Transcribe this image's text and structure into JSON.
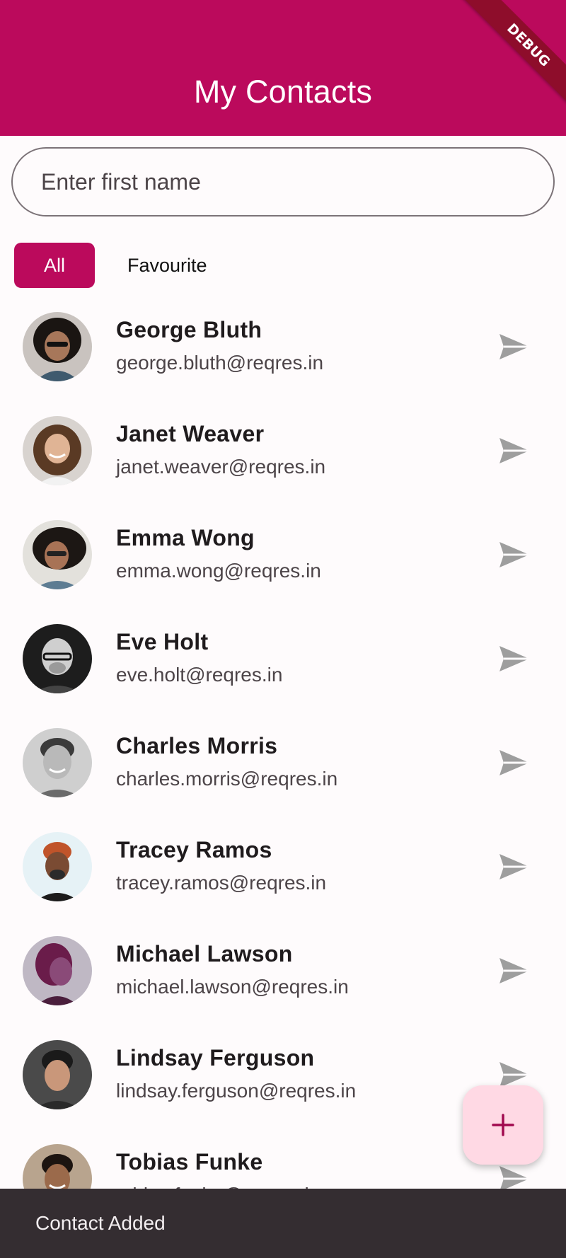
{
  "appbar": {
    "title": "My Contacts",
    "debug_label": "DEBUG"
  },
  "search": {
    "placeholder": "Enter first name",
    "value": ""
  },
  "filters": {
    "all_label": "All",
    "favourite_label": "Favourite",
    "selected": "All"
  },
  "contacts": [
    {
      "name": "George Bluth",
      "email": "george.bluth@reqres.in",
      "avatar_icon": "person-avatar"
    },
    {
      "name": "Janet Weaver",
      "email": "janet.weaver@reqres.in",
      "avatar_icon": "person-avatar"
    },
    {
      "name": "Emma Wong",
      "email": "emma.wong@reqres.in",
      "avatar_icon": "person-avatar"
    },
    {
      "name": "Eve Holt",
      "email": "eve.holt@reqres.in",
      "avatar_icon": "person-avatar"
    },
    {
      "name": "Charles Morris",
      "email": "charles.morris@reqres.in",
      "avatar_icon": "person-avatar"
    },
    {
      "name": "Tracey Ramos",
      "email": "tracey.ramos@reqres.in",
      "avatar_icon": "person-avatar"
    },
    {
      "name": "Michael Lawson",
      "email": "michael.lawson@reqres.in",
      "avatar_icon": "person-avatar"
    },
    {
      "name": "Lindsay Ferguson",
      "email": "lindsay.ferguson@reqres.in",
      "avatar_icon": "person-avatar"
    },
    {
      "name": "Tobias Funke",
      "email": "tobias.funke@reqres.in",
      "avatar_icon": "person-avatar"
    }
  ],
  "fab": {
    "label": "+",
    "icon": "plus-icon"
  },
  "snackbar": {
    "message": "Contact Added"
  },
  "colors": {
    "primary": "#bb0a5c",
    "fab_background": "#ffd9e4",
    "snackbar_background": "#342d31",
    "send_icon": "#9e9e9e"
  }
}
